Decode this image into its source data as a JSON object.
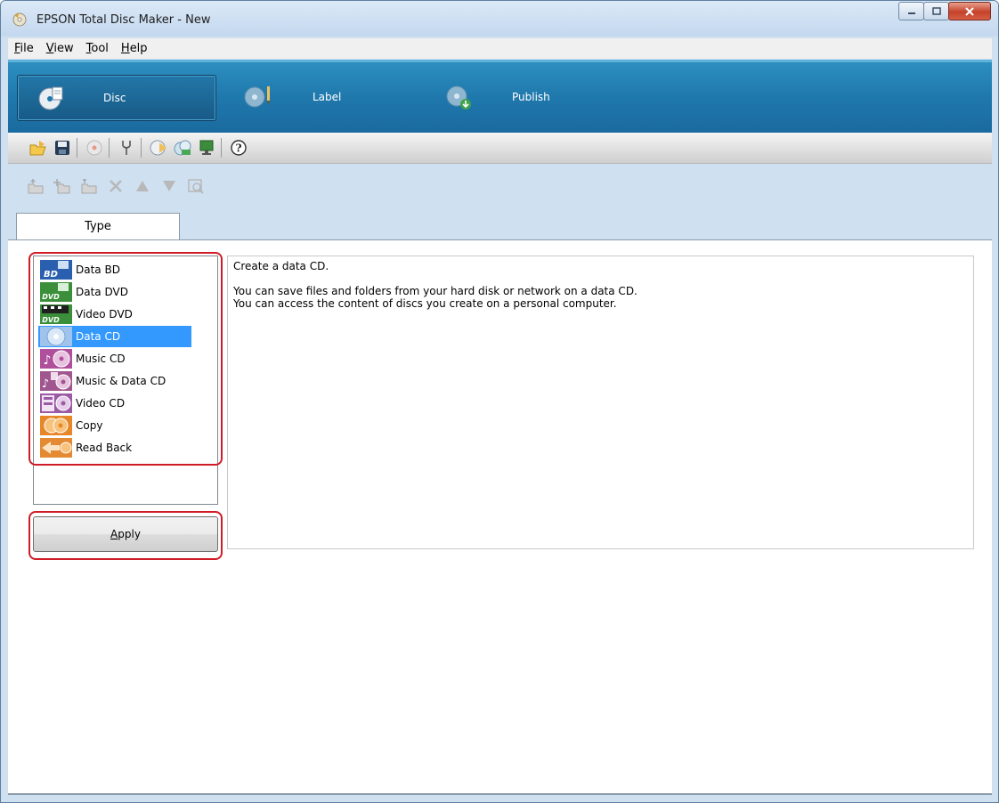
{
  "window": {
    "title": "EPSON Total Disc Maker - New",
    "controls": [
      "minimize",
      "maximize",
      "close"
    ]
  },
  "menu": [
    {
      "label": "File",
      "mnemonic": "F"
    },
    {
      "label": "View",
      "mnemonic": "V"
    },
    {
      "label": "Tool",
      "mnemonic": "T"
    },
    {
      "label": "Help",
      "mnemonic": "H"
    }
  ],
  "modes": [
    {
      "label": "Disc",
      "icon": "disc-icon",
      "active": true
    },
    {
      "label": "Label",
      "icon": "label-icon",
      "active": false
    },
    {
      "label": "Publish",
      "icon": "publish-icon",
      "active": false
    }
  ],
  "toolbar": {
    "buttons": [
      "open-folder-icon",
      "save-icon",
      "disc-burn-icon",
      "settings-icon",
      "disc-write-icon",
      "disc-copy-icon",
      "monitor-icon",
      "help-icon"
    ]
  },
  "edit_toolbar": {
    "buttons": [
      "add-folder-icon",
      "new-folder-icon",
      "rename-folder-icon",
      "delete-icon",
      "move-up-icon",
      "move-down-icon",
      "preview-icon"
    ]
  },
  "tabs": [
    {
      "label": "Type"
    }
  ],
  "disc_types": [
    {
      "label": "Data BD",
      "icon": "bd-icon",
      "selected": false
    },
    {
      "label": "Data DVD",
      "icon": "dvd-icon",
      "selected": false
    },
    {
      "label": "Video DVD",
      "icon": "video-dvd-icon",
      "selected": false
    },
    {
      "label": "Data CD",
      "icon": "data-cd-icon",
      "selected": true
    },
    {
      "label": "Music CD",
      "icon": "music-cd-icon",
      "selected": false
    },
    {
      "label": "Music & Data CD",
      "icon": "music-data-cd-icon",
      "selected": false
    },
    {
      "label": "Video CD",
      "icon": "video-cd-icon",
      "selected": false
    },
    {
      "label": "Copy",
      "icon": "copy-icon",
      "selected": false
    },
    {
      "label": "Read Back",
      "icon": "read-back-icon",
      "selected": false
    }
  ],
  "apply_button": {
    "label": "Apply",
    "mnemonic": "A"
  },
  "description": {
    "line1": "Create a data CD.",
    "line2": "You can save files and folders from your hard disk or network on a data CD.",
    "line3": "You can access the content of discs you create on a personal computer."
  },
  "colors": {
    "accent": "#1f78ac",
    "selection": "#3399ff",
    "highlight_box": "#d01c26"
  }
}
